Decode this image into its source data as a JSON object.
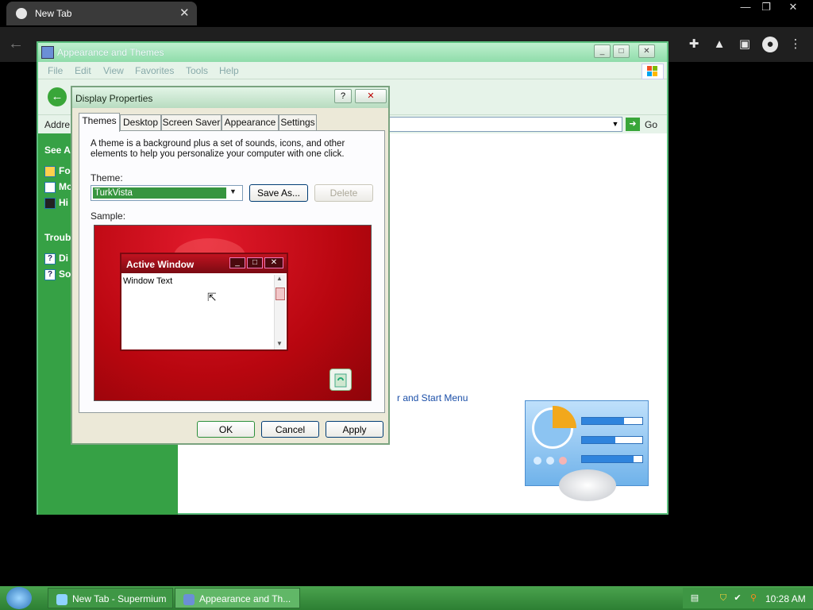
{
  "browser": {
    "tab_title": "New Tab",
    "close_glyph": "✕",
    "window_controls": {
      "minimize": "—",
      "maximize": "❐",
      "close": "✕"
    },
    "back_glyph": "←",
    "toolbar_icons": [
      "puzzle-icon",
      "flask-icon",
      "sidepanel-icon",
      "profile-icon",
      "menu-icon"
    ]
  },
  "aat_window": {
    "title": "Appearance and Themes",
    "controls": {
      "minimize": "_",
      "maximize": "□",
      "close": "✕"
    },
    "menu": [
      "File",
      "Edit",
      "View",
      "Favorites",
      "Tools",
      "Help"
    ],
    "address_label": "Addre",
    "go_label": "Go",
    "left_pane": {
      "see_also_heading": "See Al",
      "see_also_items": [
        "Fo",
        "Mo",
        "Hi"
      ],
      "troubleshoot_heading": "Troubl",
      "troubleshoot_items": [
        "Di",
        "So"
      ]
    },
    "visible_link": "r and Start Menu"
  },
  "display_properties": {
    "title": "Display Properties",
    "help_glyph": "?",
    "close_glyph": "✕",
    "tabs": [
      "Themes",
      "Desktop",
      "Screen Saver",
      "Appearance",
      "Settings"
    ],
    "active_tab": "Themes",
    "description": "A theme is a background plus a set of sounds, icons, and other elements to help you personalize your computer with one click.",
    "theme_label": "Theme:",
    "theme_value": "TurkVista",
    "save_as_label": "Save As...",
    "delete_label": "Delete",
    "sample_label": "Sample:",
    "sample_window_title": "Active Window",
    "sample_window_text": "Window Text",
    "ok_label": "OK",
    "cancel_label": "Cancel",
    "apply_label": "Apply"
  },
  "taskbar": {
    "items": [
      "New Tab - Supermium",
      "Appearance and Th..."
    ],
    "clock": "10:28 AM"
  }
}
